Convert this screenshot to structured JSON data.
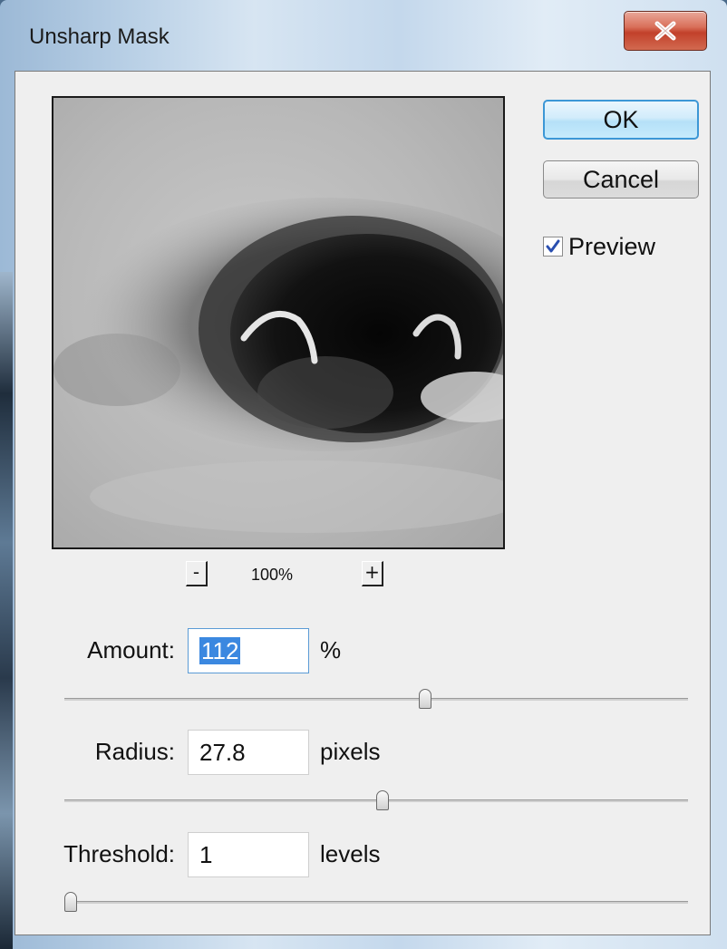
{
  "window": {
    "title": "Unsharp Mask",
    "close_icon": "close-icon"
  },
  "buttons": {
    "ok": "OK",
    "cancel": "Cancel"
  },
  "preview": {
    "checked": true,
    "label": "Preview"
  },
  "zoom": {
    "minus": "-",
    "level": "100%",
    "plus": "+"
  },
  "amount": {
    "label": "Amount:",
    "value": "112",
    "unit": "%",
    "slider_position": 0.58
  },
  "radius": {
    "label": "Radius:",
    "value": "27.8",
    "unit": "pixels",
    "slider_position": 0.51
  },
  "threshold": {
    "label": "Threshold:",
    "value": "1",
    "unit": "levels",
    "slider_position": 0.0
  }
}
